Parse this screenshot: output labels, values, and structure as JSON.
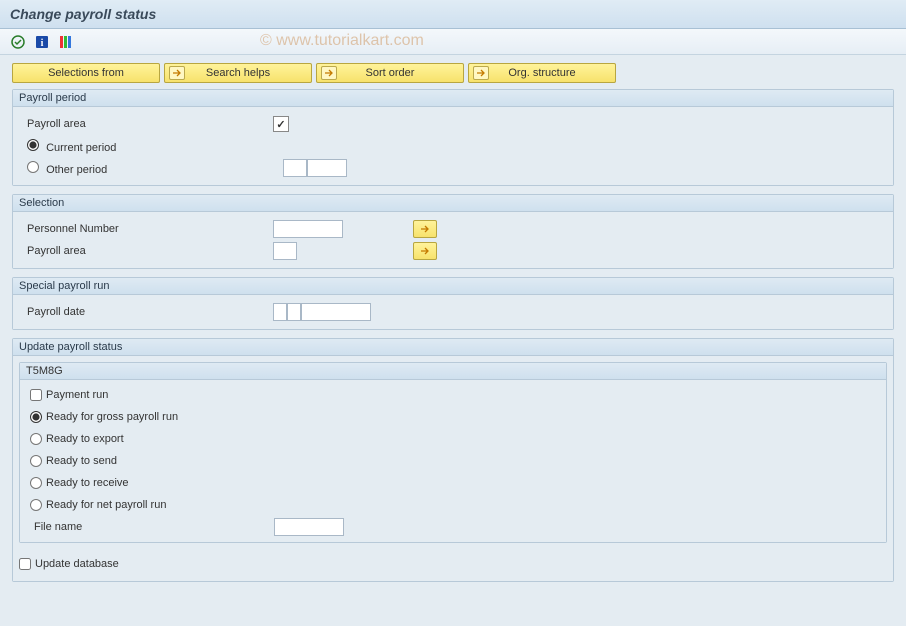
{
  "title": "Change payroll status",
  "watermark": "© www.tutorialkart.com",
  "buttons": {
    "selections_from": "Selections from",
    "search_helps": "Search helps",
    "sort_order": "Sort order",
    "org_structure": "Org. structure"
  },
  "payroll_period": {
    "header": "Payroll period",
    "payroll_area_label": "Payroll area",
    "payroll_area_checked": "✓",
    "current_period": "Current period",
    "other_period": "Other period"
  },
  "selection": {
    "header": "Selection",
    "personnel_number": "Personnel Number",
    "payroll_area": "Payroll area"
  },
  "special": {
    "header": "Special payroll run",
    "payroll_date": "Payroll date"
  },
  "update": {
    "header": "Update payroll status",
    "sub_header": "T5M8G",
    "payment_run": "Payment run",
    "ready_gross": "Ready for gross payroll run",
    "ready_export": "Ready to export",
    "ready_send": "Ready to send",
    "ready_receive": "Ready to receive",
    "ready_net": "Ready for net payroll run",
    "file_name": "File name"
  },
  "update_database": "Update database"
}
